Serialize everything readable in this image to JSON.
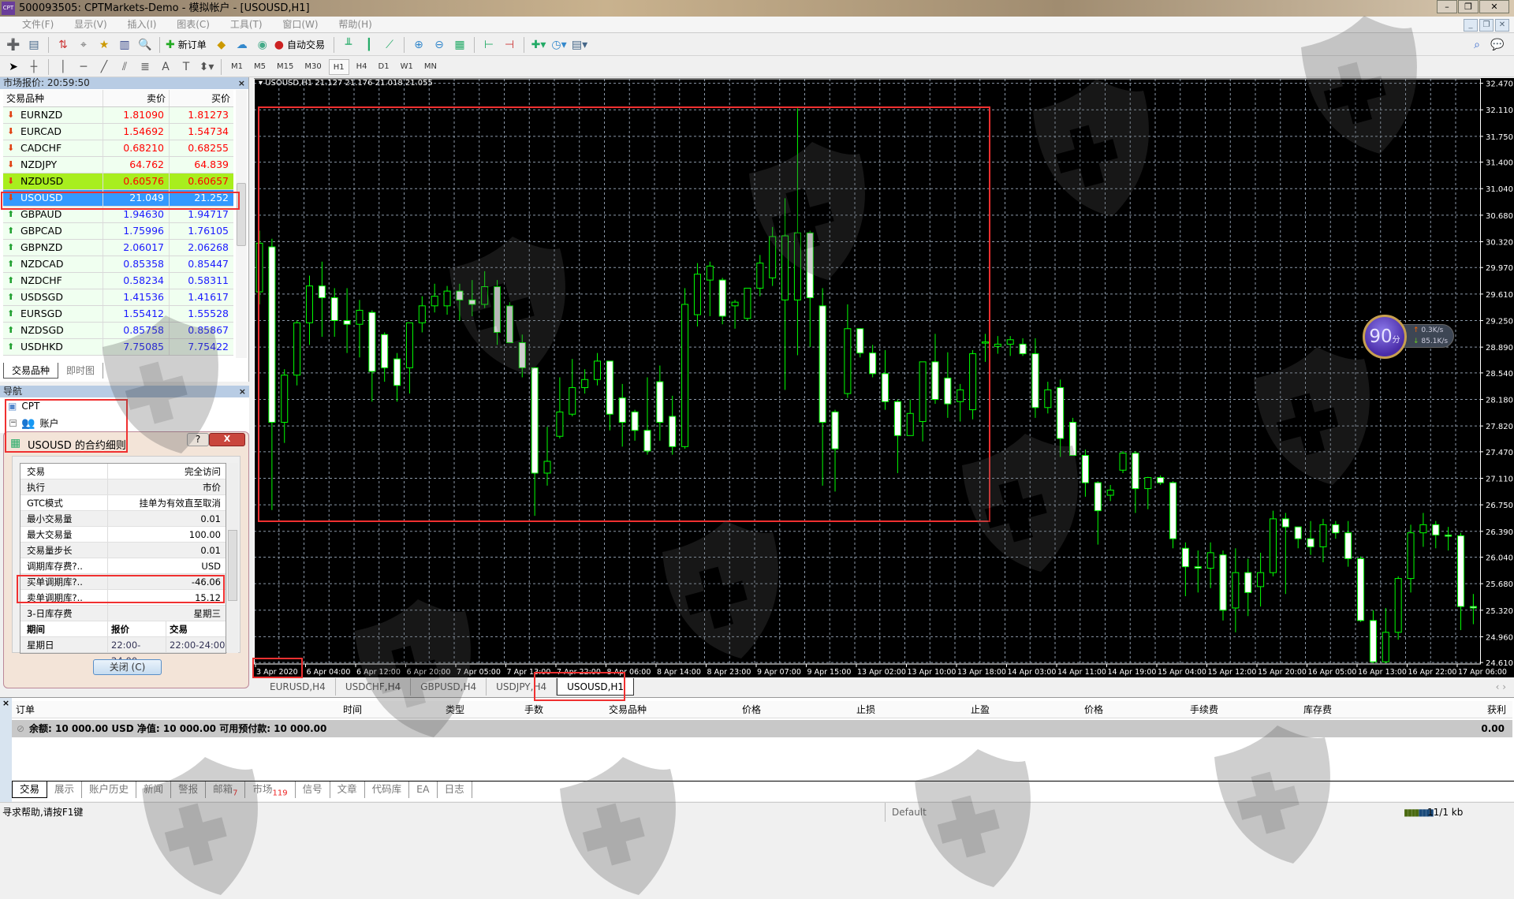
{
  "window": {
    "title": "500093505: CPTMarkets-Demo - 模拟帐户 - [USOUSD,H1]",
    "logo": "CPT"
  },
  "menu": [
    "文件(F)",
    "显示(V)",
    "插入(I)",
    "图表(C)",
    "工具(T)",
    "窗口(W)",
    "帮助(H)"
  ],
  "toolbar": {
    "new_order": "新订单",
    "auto_trading": "自动交易",
    "timeframes": [
      "M1",
      "M5",
      "M15",
      "M30",
      "H1",
      "H4",
      "D1",
      "W1",
      "MN"
    ],
    "active_timeframe": "H1"
  },
  "market_watch": {
    "title": "市场报价: 20:59:50",
    "columns": [
      "交易品种",
      "卖价",
      "买价"
    ],
    "rows": [
      {
        "symbol": "EURNZD",
        "bid": "1.81090",
        "ask": "1.81273",
        "dir": "down"
      },
      {
        "symbol": "EURCAD",
        "bid": "1.54692",
        "ask": "1.54734",
        "dir": "down"
      },
      {
        "symbol": "CADCHF",
        "bid": "0.68210",
        "ask": "0.68255",
        "dir": "down"
      },
      {
        "symbol": "NZDJPY",
        "bid": "64.762",
        "ask": "64.839",
        "dir": "down"
      },
      {
        "symbol": "NZDUSD",
        "bid": "0.60576",
        "ask": "0.60657",
        "dir": "down",
        "state": "highlight"
      },
      {
        "symbol": "USOUSD",
        "bid": "21.049",
        "ask": "21.252",
        "dir": "down",
        "state": "selected"
      },
      {
        "symbol": "GBPAUD",
        "bid": "1.94630",
        "ask": "1.94717",
        "dir": "up"
      },
      {
        "symbol": "GBPCAD",
        "bid": "1.75996",
        "ask": "1.76105",
        "dir": "up"
      },
      {
        "symbol": "GBPNZD",
        "bid": "2.06017",
        "ask": "2.06268",
        "dir": "up"
      },
      {
        "symbol": "NZDCAD",
        "bid": "0.85358",
        "ask": "0.85447",
        "dir": "up"
      },
      {
        "symbol": "NZDCHF",
        "bid": "0.58234",
        "ask": "0.58311",
        "dir": "up"
      },
      {
        "symbol": "USDSGD",
        "bid": "1.41536",
        "ask": "1.41617",
        "dir": "up"
      },
      {
        "symbol": "EURSGD",
        "bid": "1.55412",
        "ask": "1.55528",
        "dir": "up"
      },
      {
        "symbol": "NZDSGD",
        "bid": "0.85758",
        "ask": "0.85867",
        "dir": "up"
      },
      {
        "symbol": "USDHKD",
        "bid": "7.75085",
        "ask": "7.75422",
        "dir": "up"
      }
    ],
    "tabs": [
      "交易品种",
      "即时图"
    ]
  },
  "navigator": {
    "title": "导航",
    "items": [
      "CPT",
      "账户"
    ]
  },
  "contract_dialog": {
    "title": "USOUSD 的合约细则",
    "help": "?",
    "close_x": "X",
    "rows": [
      [
        "交易",
        "完全访问"
      ],
      [
        "执行",
        "市价"
      ],
      [
        "GTC模式",
        "挂单为有效直至取消"
      ],
      [
        "最小交易量",
        "0.01"
      ],
      [
        "最大交易量",
        "100.00"
      ],
      [
        "交易量步长",
        "0.01"
      ],
      [
        "调期库存费?..",
        "USD"
      ],
      [
        "买单调期库?..",
        "-46.06"
      ],
      [
        "卖单调期库?..",
        "15.12"
      ],
      [
        "3-日库存费",
        "星期三"
      ]
    ],
    "session_header": [
      "期间",
      "报价",
      "交易"
    ],
    "session_rows": [
      [
        "星期日",
        "22:00-24:00",
        "22:00-24:00"
      ]
    ],
    "close_button": "关闭 (C)"
  },
  "chart": {
    "header": "USOUSD,H1  21.127 21.176 21.018 21.055"
  },
  "speed_widget": {
    "score": "90",
    "unit": "分",
    "upload": "0.3K/s",
    "download": "85.1K/s"
  },
  "chart_data": {
    "type": "candlestick",
    "title": "USOUSD,H1",
    "ylim": [
      24.59,
      32.53
    ],
    "y_ticks": [
      "32.470",
      "32.110",
      "31.750",
      "31.400",
      "31.040",
      "30.680",
      "30.320",
      "29.970",
      "29.610",
      "29.250",
      "28.890",
      "28.540",
      "28.180",
      "27.820",
      "27.470",
      "27.110",
      "26.750",
      "26.390",
      "26.040",
      "25.680",
      "25.320",
      "24.960",
      "24.610"
    ],
    "x_ticks": [
      "3 Apr 2020",
      "6 Apr 04:00",
      "6 Apr 12:00",
      "6 Apr 20:00",
      "7 Apr 05:00",
      "7 Apr 13:00",
      "7 Apr 22:00",
      "8 Apr 06:00",
      "8 Apr 14:00",
      "8 Apr 23:00",
      "9 Apr 07:00",
      "9 Apr 15:00",
      "13 Apr 02:00",
      "13 Apr 10:00",
      "13 Apr 18:00",
      "14 Apr 03:00",
      "14 Apr 11:00",
      "14 Apr 19:00",
      "15 Apr 04:00",
      "15 Apr 12:00",
      "15 Apr 20:00",
      "16 Apr 05:00",
      "16 Apr 13:00",
      "16 Apr 22:00",
      "17 Apr 06:00"
    ],
    "ohlc": [
      [
        29.64,
        30.47,
        29.47,
        30.3
      ],
      [
        30.25,
        30.36,
        26.68,
        27.87
      ],
      [
        27.87,
        28.59,
        27.59,
        28.51
      ],
      [
        28.51,
        29.25,
        28.37,
        29.22
      ],
      [
        29.22,
        29.86,
        28.92,
        29.72
      ],
      [
        29.72,
        30.05,
        29.03,
        29.56
      ],
      [
        29.56,
        29.69,
        29.03,
        29.25
      ],
      [
        29.25,
        29.69,
        28.81,
        29.2
      ],
      [
        29.2,
        29.53,
        28.75,
        29.39
      ],
      [
        29.36,
        29.39,
        28.15,
        28.56
      ],
      [
        29.06,
        29.09,
        28.42,
        28.61
      ],
      [
        28.73,
        28.81,
        28.15,
        28.37
      ],
      [
        28.61,
        28.92,
        28.26,
        29.22
      ],
      [
        29.22,
        29.58,
        29.09,
        29.45
      ],
      [
        29.45,
        29.75,
        29.36,
        29.58
      ],
      [
        29.45,
        29.72,
        29.33,
        29.65
      ],
      [
        29.65,
        29.75,
        29.25,
        29.53
      ],
      [
        29.53,
        29.8,
        29.31,
        29.47
      ],
      [
        29.47,
        29.92,
        29.42,
        29.71
      ],
      [
        29.71,
        29.8,
        28.92,
        29.09
      ],
      [
        29.45,
        29.5,
        28.95,
        28.95
      ],
      [
        28.95,
        29.06,
        28.48,
        28.61
      ],
      [
        28.61,
        28.61,
        26.6,
        27.18
      ],
      [
        27.18,
        27.81,
        27.01,
        27.34
      ],
      [
        27.68,
        28.48,
        27.65,
        28.01
      ],
      [
        27.98,
        28.73,
        27.95,
        28.34
      ],
      [
        28.34,
        28.59,
        28.26,
        28.45
      ],
      [
        28.45,
        28.81,
        28.37,
        28.7
      ],
      [
        28.7,
        28.7,
        27.76,
        27.98
      ],
      [
        28.2,
        28.39,
        27.54,
        27.87
      ],
      [
        28.01,
        28.04,
        27.62,
        27.76
      ],
      [
        27.76,
        28.48,
        27.43,
        27.48
      ],
      [
        28.42,
        28.64,
        27.62,
        27.87
      ],
      [
        27.95,
        28.23,
        27.43,
        27.54
      ],
      [
        27.54,
        29.69,
        27.51,
        29.47
      ],
      [
        29.33,
        30.03,
        29.17,
        29.88
      ],
      [
        29.8,
        30.05,
        29.31,
        29.99
      ],
      [
        29.8,
        29.83,
        29.2,
        29.31
      ],
      [
        29.45,
        29.53,
        29.14,
        29.5
      ],
      [
        29.28,
        29.69,
        29.25,
        29.69
      ],
      [
        29.69,
        30.14,
        29.58,
        30.03
      ],
      [
        29.83,
        30.52,
        29.72,
        30.39
      ],
      [
        29.53,
        30.91,
        28.31,
        30.4
      ],
      [
        29.53,
        32.13,
        28.78,
        30.44
      ],
      [
        30.44,
        30.47,
        28.89,
        29.56
      ],
      [
        29.45,
        29.69,
        27.01,
        27.87
      ],
      [
        28.01,
        28.04,
        26.93,
        27.51
      ],
      [
        28.26,
        29.47,
        28.2,
        29.14
      ],
      [
        29.14,
        29.14,
        28.75,
        28.81
      ],
      [
        28.81,
        28.92,
        28.48,
        28.53
      ],
      [
        28.53,
        28.85,
        28.04,
        28.15
      ],
      [
        28.15,
        28.18,
        27.18,
        27.69
      ],
      [
        27.69,
        28.18,
        27.69,
        27.99
      ],
      [
        27.88,
        28.69,
        27.61,
        28.69
      ],
      [
        28.69,
        29.07,
        28.12,
        28.18
      ],
      [
        28.47,
        28.82,
        27.93,
        28.12
      ],
      [
        28.15,
        28.39,
        27.88,
        28.31
      ],
      [
        28.04,
        28.85,
        27.91,
        28.8
      ],
      [
        28.96,
        29.07,
        28.69,
        28.96
      ],
      [
        28.9,
        29.04,
        28.8,
        28.93
      ],
      [
        28.93,
        29.04,
        28.77,
        28.99
      ],
      [
        28.93,
        29.01,
        28.77,
        28.8
      ],
      [
        28.8,
        29.01,
        27.93,
        28.07
      ],
      [
        28.07,
        28.42,
        27.99,
        28.31
      ],
      [
        28.34,
        28.45,
        27.4,
        27.65
      ],
      [
        27.87,
        27.93,
        27.42,
        27.42
      ],
      [
        27.42,
        27.5,
        26.86,
        27.05
      ],
      [
        27.05,
        27.07,
        26.21,
        26.67
      ],
      [
        26.88,
        27.02,
        26.8,
        26.95
      ],
      [
        27.22,
        27.48,
        27.18,
        27.45
      ],
      [
        27.45,
        27.48,
        26.64,
        26.97
      ],
      [
        26.97,
        27.13,
        26.69,
        27.12
      ],
      [
        27.12,
        27.15,
        27.02,
        27.05
      ],
      [
        27.05,
        27.07,
        26.16,
        26.29
      ],
      [
        26.16,
        26.24,
        25.51,
        25.91
      ],
      [
        25.91,
        26.13,
        25.56,
        25.89
      ],
      [
        25.89,
        26.24,
        25.62,
        26.1
      ],
      [
        26.07,
        26.13,
        25.18,
        25.32
      ],
      [
        25.35,
        26.16,
        25.02,
        25.83
      ],
      [
        25.83,
        26.02,
        25.24,
        25.56
      ],
      [
        25.64,
        26.1,
        25.37,
        25.83
      ],
      [
        25.83,
        26.67,
        25.78,
        26.56
      ],
      [
        26.56,
        26.64,
        25.54,
        26.45
      ],
      [
        26.45,
        26.45,
        26.16,
        26.29
      ],
      [
        26.29,
        26.53,
        26.07,
        26.18
      ],
      [
        26.18,
        26.56,
        25.97,
        26.48
      ],
      [
        26.48,
        26.53,
        26.29,
        26.37
      ],
      [
        26.37,
        26.53,
        25.91,
        26.02
      ],
      [
        26.02,
        26.05,
        25.16,
        25.18
      ],
      [
        25.18,
        25.32,
        24.6,
        24.62
      ],
      [
        24.62,
        25.35,
        24.6,
        25.02
      ],
      [
        25.02,
        25.78,
        24.92,
        25.75
      ],
      [
        25.75,
        26.48,
        25.56,
        26.37
      ],
      [
        26.37,
        26.64,
        26.18,
        26.48
      ],
      [
        26.48,
        26.53,
        26.16,
        26.34
      ],
      [
        26.34,
        26.45,
        26.13,
        26.33
      ],
      [
        26.33,
        26.37,
        25.05,
        25.37
      ],
      [
        25.37,
        25.54,
        25.13,
        25.35
      ]
    ],
    "colors": {
      "background": "#000000",
      "grid": "#8b98a8",
      "bull_outline": "#00ff00",
      "bear_fill": "#ffffff",
      "axis_text": "#ffffff"
    }
  },
  "chart_tabs": [
    "EURUSD,H4",
    "USDCHF,H4",
    "GBPUSD,H4",
    "USDJPY,H4",
    "USOUSD,H1"
  ],
  "active_chart_tab": "USOUSD,H1",
  "terminal": {
    "columns": [
      "订单",
      "时间",
      "类型",
      "手数",
      "交易品种",
      "价格",
      "止损",
      "止盈",
      "价格",
      "手续费",
      "库存费",
      "获利"
    ],
    "balance_line": "余额: 10 000.00 USD  净值: 10 000.00  可用预付款: 10 000.00",
    "profit": "0.00",
    "tabs": [
      {
        "label": "交易"
      },
      {
        "label": "展示"
      },
      {
        "label": "账户历史"
      },
      {
        "label": "新闻"
      },
      {
        "label": "警报"
      },
      {
        "label": "邮箱",
        "badge": "7"
      },
      {
        "label": "市场",
        "badge": "119"
      },
      {
        "label": "信号"
      },
      {
        "label": "文章"
      },
      {
        "label": "代码库"
      },
      {
        "label": "EA"
      },
      {
        "label": "日志"
      }
    ]
  },
  "status_bar": {
    "help": "寻求帮助,请按F1键",
    "profile": "Default",
    "traffic": "11/1 kb"
  }
}
